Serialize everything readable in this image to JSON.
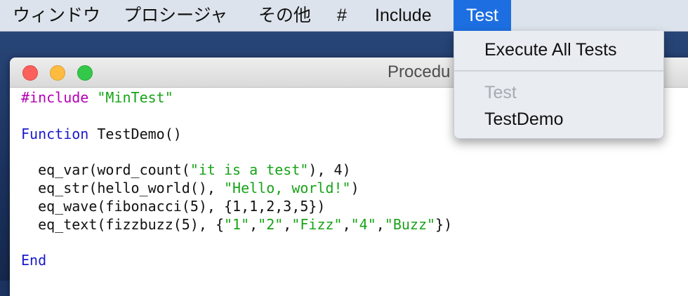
{
  "menubar": {
    "items": [
      {
        "label": "ウィンドウ"
      },
      {
        "label": "プロシージャ"
      },
      {
        "label": "その他"
      },
      {
        "label": "#"
      },
      {
        "label": "Include"
      },
      {
        "label": "Test",
        "active": true
      }
    ]
  },
  "window": {
    "title": "Procedu",
    "code": {
      "include_directive": "#include",
      "include_file": "\"MinTest\"",
      "function_keyword": "Function",
      "function_signature": " TestDemo()",
      "line1_a": "  eq_var(word_count(",
      "line1_str": "\"it is a test\"",
      "line1_b": "), 4)",
      "line2_a": "  eq_str(hello_world(), ",
      "line2_str": "\"Hello, world!\"",
      "line2_b": ")",
      "line3": "  eq_wave(fibonacci(5), {1,1,2,3,5})",
      "line4_a": "  eq_text(fizzbuzz(5), {",
      "line4_s1": "\"1\"",
      "comma": ",",
      "line4_s2": "\"2\"",
      "line4_s3": "\"Fizz\"",
      "line4_s4": "\"4\"",
      "line4_s5": "\"Buzz\"",
      "line4_b": "})",
      "end_keyword": "End"
    }
  },
  "dropdown": {
    "execute_all": "Execute All Tests",
    "section_header": "Test",
    "items": [
      "TestDemo"
    ]
  },
  "colors": {
    "menu_highlight": "#1d6fe1",
    "directive": "#b400b4",
    "string": "#17a317",
    "keyword": "#1a1acc"
  }
}
